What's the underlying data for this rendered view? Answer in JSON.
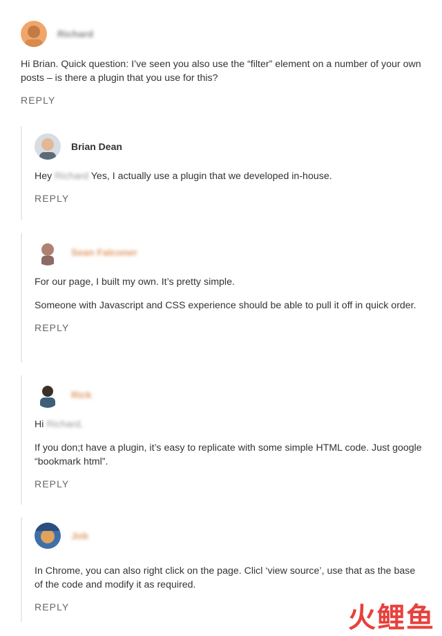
{
  "comments": [
    {
      "author": "Richard",
      "text": "Hi Brian. Quick question: I’ve seen you also use the “filter” element on a number of your own posts – is there a plugin that you use for this?",
      "reply_label": "REPLY"
    }
  ],
  "replies": [
    {
      "author": "Brian Dean",
      "greeting": "Hey",
      "mention": "Richard",
      "text": "Yes, I actually use a plugin that we developed in-house.",
      "reply_label": "REPLY"
    },
    {
      "author": "Sean Falconer",
      "paragraphs": [
        "For our page, I built my own. It’s pretty simple.",
        "Someone with Javascript and CSS experience should be able to pull it off in quick order."
      ],
      "reply_label": "REPLY"
    },
    {
      "author": "Rick",
      "greeting": "Hi",
      "mention": "Richard,",
      "text": "If you don;t have a plugin, it’s easy to replicate with some simple HTML code. Just google “bookmark html”.",
      "reply_label": "REPLY"
    },
    {
      "author": "Job",
      "text": "In Chrome, you can also right click on the page. Clicl ‘view source’, use that as the base of the code and modify it as required.",
      "reply_label": "REPLY"
    }
  ],
  "watermark": {
    "chars": [
      "火",
      "鲤",
      "鱼"
    ],
    "colors": [
      "#e8413c",
      "#e8413c",
      "#e8413c"
    ]
  }
}
